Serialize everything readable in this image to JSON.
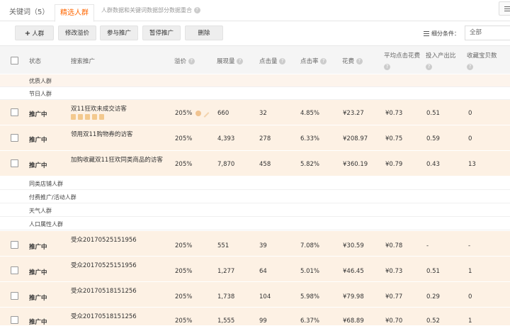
{
  "tabs": {
    "keywords": "关键词（5）",
    "people": "精选人群",
    "note": "人群数据和关键词数据部分数据重合"
  },
  "toolbar": {
    "add": "人群",
    "modify_bid": "修改溢价",
    "join": "参与推广",
    "pause": "暂停推广",
    "delete": "删除",
    "filter_label": "细分条件：",
    "filter_value": "全部"
  },
  "columns": {
    "status": "状态",
    "search": "搜索推广",
    "premium": "溢价",
    "impressions": "展现量",
    "clicks": "点击量",
    "ctr": "点击率",
    "cost": "花费",
    "avg_cpc": "平均点击花费",
    "roi": "投入产出比",
    "favorites": "收藏宝贝数"
  },
  "groups": {
    "quality": "优质人群",
    "holiday": "节日人群",
    "similar_store": "同类店铺人群",
    "paid_activity": "付费推广/活动人群",
    "weather": "天气人群",
    "demographic": "人口属性人群"
  },
  "rows": [
    {
      "status": "推广中",
      "name": "双11狂欢未成交访客",
      "premium": "205%",
      "impressions": "660",
      "clicks": "32",
      "ctr": "4.85%",
      "cost": "¥23.27",
      "avg_cpc": "¥0.73",
      "roi": "0.51",
      "favorites": "0"
    },
    {
      "status": "推广中",
      "name": "领用双11购物券的访客",
      "premium": "205%",
      "impressions": "4,393",
      "clicks": "278",
      "ctr": "6.33%",
      "cost": "¥208.97",
      "avg_cpc": "¥0.75",
      "roi": "0.59",
      "favorites": "0"
    },
    {
      "status": "推广中",
      "name": "加购收藏双11狂欢同类商品的访客",
      "premium": "205%",
      "impressions": "7,870",
      "clicks": "458",
      "ctr": "5.82%",
      "cost": "¥360.19",
      "avg_cpc": "¥0.79",
      "roi": "0.43",
      "favorites": "13"
    },
    {
      "status": "推广中",
      "name": "受众20170525151956",
      "premium": "205%",
      "impressions": "551",
      "clicks": "39",
      "ctr": "7.08%",
      "cost": "¥30.59",
      "avg_cpc": "¥0.78",
      "roi": "-",
      "favorites": "-"
    },
    {
      "status": "推广中",
      "name": "受众20170525151956",
      "premium": "205%",
      "impressions": "1,277",
      "clicks": "64",
      "ctr": "5.01%",
      "cost": "¥46.45",
      "avg_cpc": "¥0.73",
      "roi": "0.51",
      "favorites": "1"
    },
    {
      "status": "推广中",
      "name": "受众20170518151256",
      "premium": "205%",
      "impressions": "1,738",
      "clicks": "104",
      "ctr": "5.98%",
      "cost": "¥79.98",
      "avg_cpc": "¥0.77",
      "roi": "0.29",
      "favorites": "0"
    },
    {
      "status": "推广中",
      "name": "受众20170518151256",
      "premium": "205%",
      "impressions": "1,555",
      "clicks": "99",
      "ctr": "6.37%",
      "cost": "¥68.89",
      "avg_cpc": "¥0.70",
      "roi": "0.52",
      "favorites": "1"
    }
  ]
}
